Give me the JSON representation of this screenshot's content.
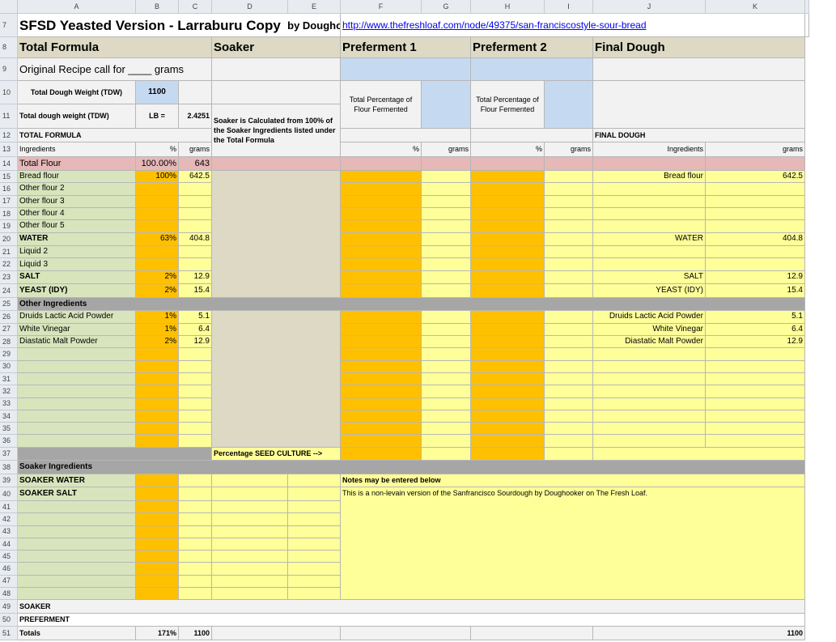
{
  "columns": [
    "A",
    "B",
    "C",
    "D",
    "E",
    "F",
    "G",
    "H",
    "I",
    "J",
    "K"
  ],
  "rows": {
    "r7": "7",
    "r8": "8",
    "r9": "9",
    "r10": "10",
    "r11": "11",
    "r12": "12",
    "r13": "13",
    "r14": "14",
    "r15": "15",
    "r16": "16",
    "r17": "17",
    "r18": "18",
    "r19": "19",
    "r20": "20",
    "r21": "21",
    "r22": "22",
    "r23": "23",
    "r24": "24",
    "r25": "25",
    "r26": "26",
    "r27": "27",
    "r28": "28",
    "r29": "29",
    "r30": "30",
    "r31": "31",
    "r32": "32",
    "r33": "33",
    "r34": "34",
    "r35": "35",
    "r36": "36",
    "r37": "37",
    "r38": "38",
    "r39": "39",
    "r40": "40",
    "r41": "41",
    "r42": "42",
    "r43": "43",
    "r44": "44",
    "r45": "45",
    "r46": "46",
    "r47": "47",
    "r48": "48",
    "r49": "49",
    "r50": "50",
    "r51": "51"
  },
  "title": {
    "main": "SFSD Yeasted Version - Larraburu Copy",
    "by": "by Doughooker - TFL",
    "link": "http://www.thefreshloaf.com/node/49375/san-franciscostyle-sour-bread"
  },
  "sections": {
    "total_formula": "Total Formula",
    "soaker": "Soaker",
    "preferment1": "Preferment 1",
    "preferment2": "Preferment 2",
    "final_dough": "Final Dough"
  },
  "recipe": {
    "original_call": "Original Recipe call for ____ grams",
    "tdw_label": "Total Dough Weight (TDW)",
    "tdw_value": "1100",
    "tdw_label2": "Total dough weight (TDW)",
    "lb_label": "LB =",
    "lb_value": "2.4251",
    "soaker_note": "Soaker is Calculated from 100% of the Soaker Ingredients listed under the Total Formula",
    "pf1_pct_label": "Total Percentage of Flour Fermented",
    "pf2_pct_label": "Total Percentage of Flour Fermented",
    "total_formula_caps": "TOTAL FORMULA",
    "final_dough_caps": "FINAL DOUGH"
  },
  "headers": {
    "ingredients": "Ingredients",
    "pct": "%",
    "grams": "grams"
  },
  "total_flour": {
    "label": "Total Flour",
    "pct": "100.00%",
    "grams": "643"
  },
  "flours": [
    {
      "label": "Bread flour",
      "pct": "100%",
      "grams": "642.5",
      "final_label": "Bread flour",
      "final_grams": "642.5"
    },
    {
      "label": "Other flour 2",
      "pct": "",
      "grams": "",
      "final_label": "",
      "final_grams": ""
    },
    {
      "label": "Other flour 3",
      "pct": "",
      "grams": "",
      "final_label": "",
      "final_grams": ""
    },
    {
      "label": "Other flour 4",
      "pct": "",
      "grams": "",
      "final_label": "",
      "final_grams": ""
    },
    {
      "label": "Other flour 5",
      "pct": "",
      "grams": "",
      "final_label": "",
      "final_grams": ""
    }
  ],
  "liquids": [
    {
      "label": "WATER",
      "pct": "63%",
      "grams": "404.8",
      "final_label": "WATER",
      "final_grams": "404.8"
    },
    {
      "label": "Liquid 2",
      "pct": "",
      "grams": "",
      "final_label": "",
      "final_grams": ""
    },
    {
      "label": "Liquid 3",
      "pct": "",
      "grams": "",
      "final_label": "",
      "final_grams": ""
    }
  ],
  "salt_yeast": [
    {
      "label": "SALT",
      "pct": "2%",
      "grams": "12.9",
      "final_label": "SALT",
      "final_grams": "12.9"
    },
    {
      "label": "YEAST (IDY)",
      "pct": "2%",
      "grams": "15.4",
      "final_label": "YEAST (IDY)",
      "final_grams": "15.4"
    }
  ],
  "other_ingredients_label": "Other Ingredients",
  "others": [
    {
      "label": "Druids Lactic Acid Powder",
      "pct": "1%",
      "grams": "5.1",
      "final_label": "Druids Lactic Acid Powder",
      "final_grams": "5.1"
    },
    {
      "label": "White Vinegar",
      "pct": "1%",
      "grams": "6.4",
      "final_label": "White Vinegar",
      "final_grams": "6.4"
    },
    {
      "label": "Diastatic Malt Powder",
      "pct": "2%",
      "grams": "12.9",
      "final_label": "Diastatic Malt Powder",
      "final_grams": "12.9"
    }
  ],
  "seed_culture_label": "Percentage SEED CULTURE  -->",
  "soaker_ingredients_label": "Soaker Ingredients",
  "soaker_rows": [
    {
      "label": "SOAKER WATER"
    },
    {
      "label": "SOAKER SALT"
    }
  ],
  "notes": {
    "header": "Notes may be entered below",
    "text": "This is a non-levain version of the Sanfrancisco Sourdough by Doughooker on The Fresh Loaf."
  },
  "footer_rows": {
    "soaker": "SOAKER",
    "preferment": "PREFERMENT",
    "totals": "Totals",
    "totals_pct": "171%",
    "totals_grams": "1100",
    "totals_final": "1100"
  },
  "colors": {
    "tan": "#ddd9c4",
    "green": "#d8e4bc",
    "orange": "#ffc000",
    "yellow": "#ffff99",
    "pink": "#e6b8b7",
    "gray": "#a6a6a6",
    "blue": "#c5d9f1"
  }
}
